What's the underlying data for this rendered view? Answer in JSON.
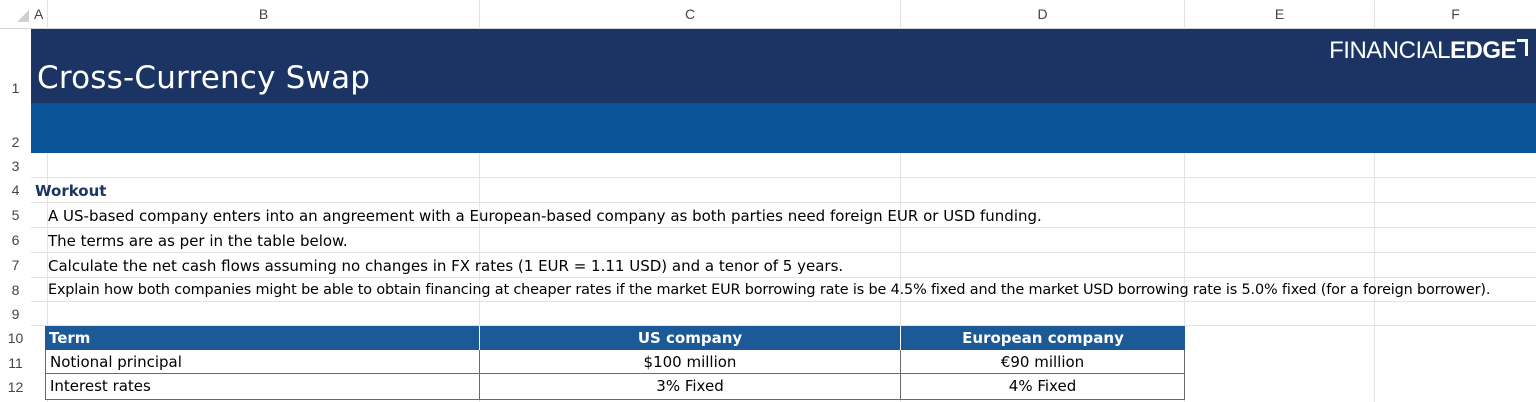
{
  "columns": [
    "A",
    "B",
    "C",
    "D",
    "E",
    "F"
  ],
  "rows": [
    "1",
    "2",
    "3",
    "4",
    "5",
    "6",
    "7",
    "8",
    "9",
    "10",
    "11",
    "12"
  ],
  "banner": {
    "title": "Cross-Currency Swap",
    "logo_thin": "FINANCIAL",
    "logo_bold": "EDGE",
    "colors": {
      "dark": "#1b3463",
      "mid": "#0a5597",
      "table_header": "#1b5a96"
    }
  },
  "workout": {
    "heading": "Workout",
    "lines": [
      "A US-based company enters into an angreement with a European-based company as both parties need foreign EUR or USD funding.",
      "The terms are as per in the table below.",
      "Calculate the net cash flows assuming no changes in FX rates (1 EUR = 1.11 USD) and a tenor of 5 years.",
      "Explain how both companies might be able to obtain financing at cheaper rates if the market EUR borrowing rate is be 4.5% fixed and the market USD borrowing rate is 5.0% fixed (for a foreign borrower)."
    ]
  },
  "table": {
    "headers": [
      "Term",
      "US company",
      "European company"
    ],
    "rows": [
      [
        "Notional principal",
        "$100 million",
        "€90 million"
      ],
      [
        "Interest rates",
        "3% Fixed",
        "4% Fixed"
      ]
    ]
  }
}
